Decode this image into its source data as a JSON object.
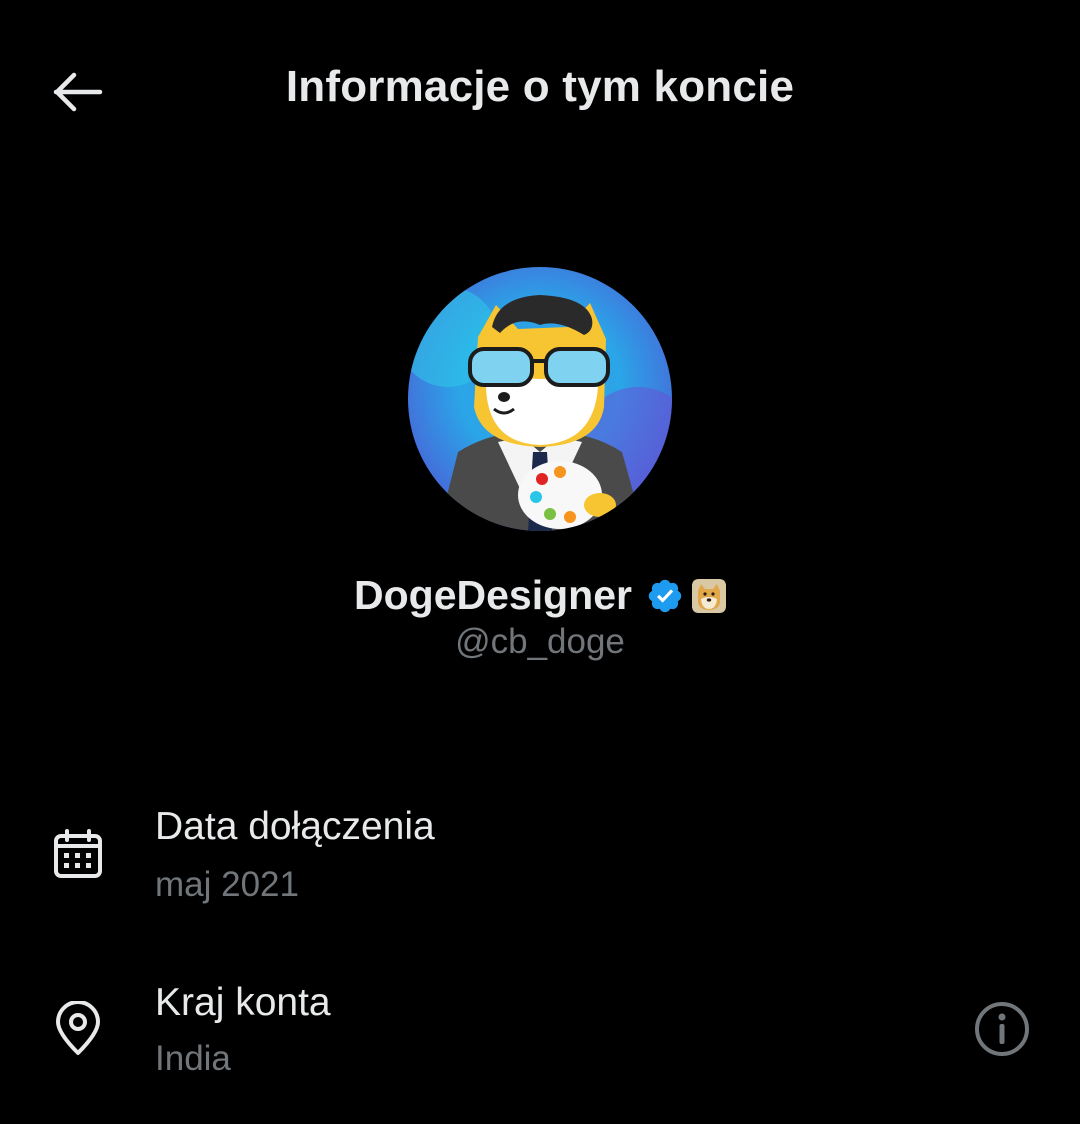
{
  "header": {
    "title": "Informacje o tym koncie",
    "back_icon": "arrow-left-icon"
  },
  "profile": {
    "display_name": "DogeDesigner",
    "handle": "@cb_doge",
    "verified_icon": "verified-badge-icon",
    "affiliate_icon": "doge-affiliate-badge-icon",
    "accent_color": "#1d9bf0"
  },
  "info": {
    "joined": {
      "label": "Data dołączenia",
      "value": "maj 2021",
      "icon": "calendar-icon"
    },
    "country": {
      "label": "Kraj konta",
      "value": "India",
      "icon": "location-pin-icon",
      "info_icon": "info-circle-icon"
    }
  },
  "colors": {
    "background": "#000000",
    "primary_text": "#e7e9ea",
    "secondary_text": "#71767b"
  }
}
